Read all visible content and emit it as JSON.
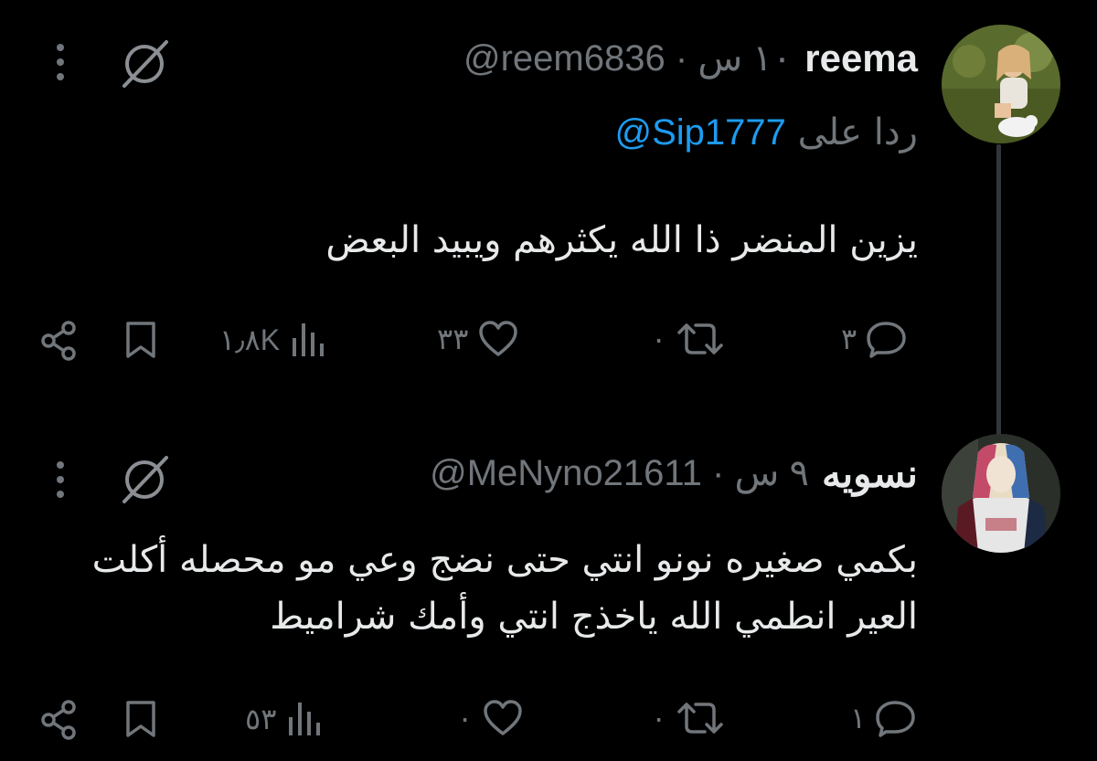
{
  "tweets": [
    {
      "display_name": "reema",
      "handle": "@reem6836",
      "time": "١٠ س",
      "separator": "·",
      "reply_prefix": "ردا على",
      "reply_mention": "@Sip1777",
      "text_lines": [
        "يزين المنضر ذا الله يكثرهم ويبيد البعض"
      ],
      "counts": {
        "replies": "٣",
        "reposts": "٠",
        "likes": "٣٣",
        "views": "١٫٨K"
      }
    },
    {
      "display_name": "نسويه",
      "handle": "@MeNyno21611",
      "time": "٩ س",
      "separator": "·",
      "text_lines": [
        "بكمي صغيره نونو انتي حتى نضج وعي مو محصله  أكلت",
        "العير انطمي الله ياخذج انتي وأمك شراميط"
      ],
      "counts": {
        "replies": "١",
        "reposts": "٠",
        "likes": "٠",
        "views": "٥٣"
      }
    }
  ],
  "icons": {
    "avatar_1": "avatar-girl-with-rabbit",
    "avatar_2": "avatar-harley-quinn",
    "grok": "grok-icon",
    "more": "more-vertical-icon",
    "reply": "reply-bubble-icon",
    "repost": "repost-icon",
    "like": "heart-icon",
    "views": "views-bar-chart-icon",
    "bookmark": "bookmark-icon",
    "share": "share-icon"
  },
  "colors": {
    "background": "#000000",
    "text_primary": "#e7e9ea",
    "text_secondary": "#71767b",
    "link": "#1d9bf0",
    "thread_line": "#333639"
  }
}
